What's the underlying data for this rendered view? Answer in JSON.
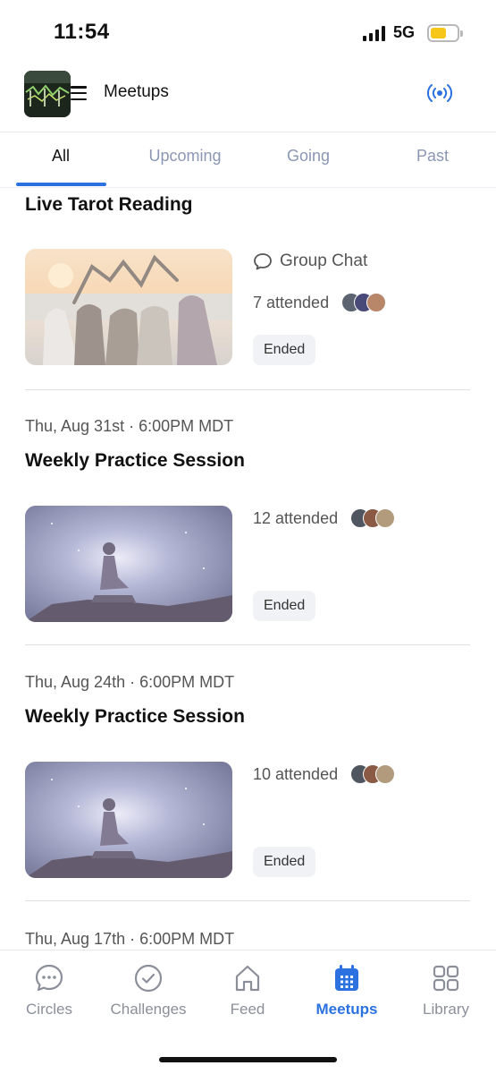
{
  "status_bar": {
    "time": "11:54",
    "network": "5G",
    "battery_level": 0.6,
    "colors": {
      "battery": "#f6c619"
    }
  },
  "header": {
    "title": "Meetups",
    "icons": {
      "menu": "hamburger-menu-icon",
      "live": "broadcast-icon"
    },
    "colors": {
      "accent": "#2b72e0"
    }
  },
  "tabs": [
    {
      "label": "All",
      "active": true
    },
    {
      "label": "Upcoming",
      "active": false
    },
    {
      "label": "Going",
      "active": false
    },
    {
      "label": "Past",
      "active": false
    }
  ],
  "meetups": [
    {
      "date": "",
      "title": "Live Tarot Reading",
      "group_chat_label": "Group Chat",
      "attended": "7 attended",
      "status": "Ended",
      "image": "friends-heart-hands-sunset"
    },
    {
      "date": "Thu, Aug 31st · 6:00PM MDT",
      "title": "Weekly Practice Session",
      "attended": "12 attended",
      "status": "Ended",
      "image": "meditation-galaxy"
    },
    {
      "date": "Thu, Aug 24th · 6:00PM MDT",
      "title": "Weekly Practice Session",
      "attended": "10 attended",
      "status": "Ended",
      "image": "meditation-galaxy"
    },
    {
      "date": "Thu, Aug 17th · 6:00PM MDT",
      "title": "",
      "attended": "",
      "status": ""
    }
  ],
  "bottom_nav": [
    {
      "label": "Circles",
      "icon": "chat-bubble-icon",
      "active": false
    },
    {
      "label": "Challenges",
      "icon": "check-circle-icon",
      "active": false
    },
    {
      "label": "Feed",
      "icon": "home-icon",
      "active": false
    },
    {
      "label": "Meetups",
      "icon": "calendar-icon",
      "active": true
    },
    {
      "label": "Library",
      "icon": "grid-icon",
      "active": false
    }
  ]
}
